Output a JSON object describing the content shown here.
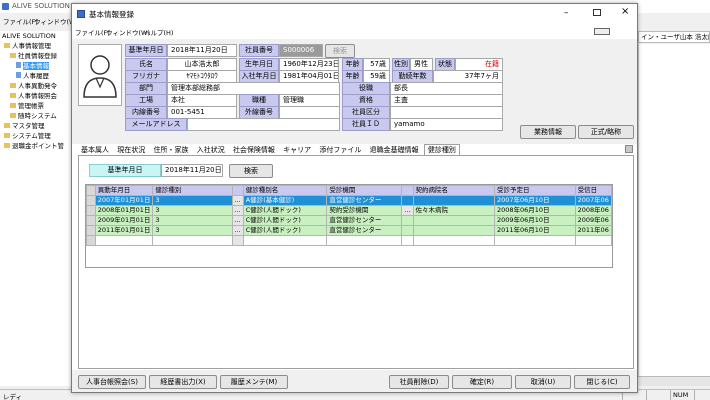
{
  "bg_app": {
    "title": "ALIVE SOLUTION",
    "menu": [
      "ファイル(F)",
      "ウィンドウ(W)"
    ],
    "tree": [
      {
        "label": "ALIVE SOLUTION",
        "indent": 0
      },
      {
        "label": "人事情報管理",
        "indent": 1
      },
      {
        "label": "社員情報登録",
        "indent": 2
      },
      {
        "label": "基本情報",
        "indent": 3,
        "selected": true
      },
      {
        "label": "人事履歴",
        "indent": 3
      },
      {
        "label": "人事異動発令",
        "indent": 2
      },
      {
        "label": "人事情報照会",
        "indent": 2
      },
      {
        "label": "管理帳票",
        "indent": 2
      },
      {
        "label": "随時システム",
        "indent": 2
      },
      {
        "label": "マスタ管理",
        "indent": 1
      },
      {
        "label": "システム管理",
        "indent": 1
      },
      {
        "label": "退職金ポイント管",
        "indent": 1
      }
    ],
    "user_label": "イン・ユーザ山本 浩太郎",
    "status_left": "レディ",
    "status_num": "NUM"
  },
  "window": {
    "title": "基本情報登録",
    "menu": [
      "ファイル(F)",
      "ウィンドウ(W)",
      "ヘルプ(H)"
    ]
  },
  "form": {
    "base_date_label": "基準年月日",
    "base_date": "2018年11月20日",
    "emp_no_label": "社員番号",
    "emp_no": "S000006",
    "search_label": "検索",
    "name_label": "氏名",
    "name": "山本浩太郎",
    "birth_label": "生年月日",
    "birth": "1960年12月23日",
    "age_label": "年齢",
    "age": "57歳",
    "gender_label": "性別",
    "gender": "男性",
    "status_label": "状態",
    "status": "在籍",
    "furigana_label": "フリガナ",
    "furigana": "ﾔﾏﾓﾄｺｳﾀﾛｳ",
    "join_label": "入社年月日",
    "join": "1981年04月01日",
    "tenure_age_label": "年齢",
    "tenure_age": "59歳",
    "tenure_label": "勤続年数",
    "tenure": "37年7ヶ月",
    "dept_label": "部門",
    "dept": "管理本部総務部",
    "title_label": "役職",
    "title": "部長",
    "plant_label": "工場",
    "plant": "本社",
    "job_label": "職種",
    "job": "管理職",
    "qual_label": "資格",
    "qual": "主査",
    "ext_label": "内線番号",
    "ext": "001-5451",
    "outside_label": "外線番号",
    "emp_type_label": "社員区分",
    "mail_label": "メールアドレス",
    "emp_id_label": "社員ＩＤ",
    "emp_id": "yamamo",
    "btn_business": "業務情報",
    "btn_official": "正式/略称"
  },
  "tabs": [
    "基本属人",
    "現在状況",
    "住所・家族",
    "入社状況",
    "社会保険情報",
    "キャリア",
    "添付ファイル",
    "退職金基礎情報",
    "健診種別"
  ],
  "active_tab": 8,
  "filter": {
    "label": "基準年月日",
    "value": "2018年11月20日",
    "search": "検索"
  },
  "table": {
    "headers": [
      "異動年月日",
      "健診種別",
      "",
      "健診種別名",
      "受診機関",
      "",
      "契約病院名",
      "受診予定日",
      "受信日"
    ],
    "rows": [
      [
        "2007年01月01日",
        "3",
        "...",
        "A健診(基本健診)",
        "直営健診センター",
        "",
        "",
        "2007年06月10日",
        "2007年06"
      ],
      [
        "2008年01月01日",
        "3",
        "...",
        "C健診(人間ドック)",
        "契約受診機関",
        "...",
        "佐々木病院",
        "2008年06月10日",
        "2008年06"
      ],
      [
        "2009年01月01日",
        "3",
        "...",
        "C健診(人間ドック)",
        "直営健診センター",
        "",
        "",
        "2009年06月10日",
        "2009年06"
      ],
      [
        "2011年01月01日",
        "3",
        "...",
        "C健診(人間ドック)",
        "直営健診センター",
        "",
        "",
        "2011年06月10日",
        "2011年06"
      ]
    ]
  },
  "bottom_buttons": {
    "b1": "人事台帳照会(S)",
    "b2": "経歴書出力(X)",
    "b3": "履歴メンテ(M)",
    "b4": "社員削除(D)",
    "b5": "確定(R)",
    "b6": "取消(U)",
    "b7": "閉じる(C)"
  },
  "colors": {
    "label_bg": "#c9c9ef",
    "selected_row": "#1f8fd6",
    "green_row": "#c9f0c0",
    "status_red": "#e00000"
  }
}
